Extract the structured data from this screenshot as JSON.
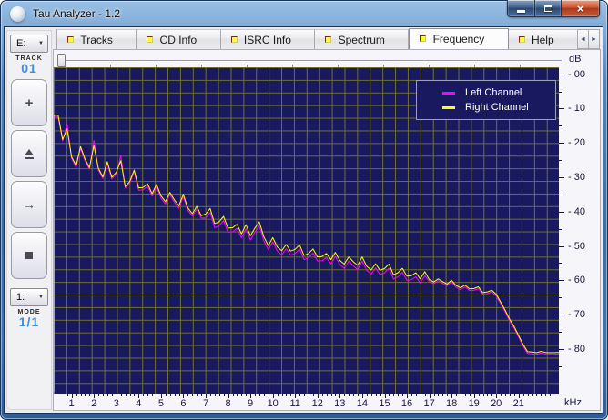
{
  "window": {
    "title": "Tau Analyzer - 1.2",
    "controls": {
      "close_glyph": "×"
    }
  },
  "tabs": [
    {
      "label": "Tracks",
      "active": false
    },
    {
      "label": "CD Info",
      "active": false
    },
    {
      "label": "ISRC Info",
      "active": false
    },
    {
      "label": "Spectrum",
      "active": false
    },
    {
      "label": "Frequency",
      "active": true
    },
    {
      "label": "Help",
      "active": false
    }
  ],
  "tab_scroll": {
    "left_glyph": "◄",
    "right_glyph": "►"
  },
  "sidebar": {
    "drive_value": "E:",
    "track_label": "TRACK",
    "track_value": "01",
    "plus_glyph": "+",
    "next_glyph": "→",
    "mode_drop_value": "1:",
    "mode_label": "MODE",
    "mode_value": "1/1"
  },
  "legend": {
    "items": [
      {
        "label": "Left Channel",
        "color": "#ff00ff"
      },
      {
        "label": "Right Channel",
        "color": "#ffff00"
      }
    ]
  },
  "chart_data": {
    "type": "line",
    "title": "",
    "xlabel": "kHz",
    "ylabel": "dB",
    "xlim": [
      0.2,
      22.8
    ],
    "ylim": [
      -93,
      2
    ],
    "grid": true,
    "legend_position": "top-right",
    "plot_bg": "#191960",
    "grid_color": "#70702c",
    "y_tick_prefix": "- ",
    "x_ticks": [
      1,
      2,
      3,
      4,
      5,
      6,
      7,
      8,
      9,
      10,
      11,
      12,
      13,
      14,
      15,
      16,
      17,
      18,
      19,
      20,
      21
    ],
    "x_tick_labels": [
      "1",
      "2",
      "3",
      "4",
      "5",
      "6",
      "7",
      "8",
      "9",
      "10",
      "11",
      "12",
      "13",
      "14",
      "15",
      "16",
      "17",
      "18",
      "19",
      "20",
      "21"
    ],
    "y_ticks": [
      0,
      -10,
      -20,
      -30,
      -40,
      -50,
      -60,
      -70,
      -80
    ],
    "y_tick_labels": [
      "00",
      "10",
      "20",
      "30",
      "40",
      "50",
      "60",
      "70",
      "80"
    ],
    "x": [
      0.2,
      0.2,
      0.4,
      0.6,
      0.8,
      1,
      1.2,
      1.4,
      1.6,
      1.8,
      2,
      2.2,
      2.4,
      2.6,
      2.8,
      3,
      3.2,
      3.4,
      3.6,
      3.8,
      4,
      4.2,
      4.4,
      4.6,
      4.8,
      5,
      5.2,
      5.4,
      5.6,
      5.8,
      6,
      6.2,
      6.4,
      6.6,
      6.8,
      7,
      7.2,
      7.4,
      7.6,
      7.8,
      8,
      8.2,
      8.4,
      8.6,
      8.8,
      9,
      9.2,
      9.4,
      9.6,
      9.8,
      10,
      10.2,
      10.4,
      10.6,
      10.8,
      11,
      11.2,
      11.4,
      11.6,
      11.8,
      12,
      12.2,
      12.4,
      12.6,
      12.8,
      13,
      13.2,
      13.4,
      13.6,
      13.8,
      14,
      14.2,
      14.4,
      14.6,
      14.8,
      15,
      15.2,
      15.4,
      15.6,
      15.8,
      16,
      16.2,
      16.4,
      16.6,
      16.8,
      17,
      17.2,
      17.4,
      17.6,
      17.8,
      18,
      18.2,
      18.4,
      18.6,
      18.8,
      19,
      19.2,
      19.4,
      19.6,
      19.8,
      20,
      20.2,
      20.4,
      20.6,
      20.8,
      21,
      21.2,
      21.4,
      21.6,
      21.8,
      22,
      22.2,
      22.4,
      22.8
    ],
    "series": [
      {
        "name": "Left Channel",
        "color": "#ff00ff",
        "y": [
          -92.5,
          -12.5,
          -12.5,
          -19.5,
          -14.5,
          -24.5,
          -27.1,
          -21.6,
          -25.2,
          -27.7,
          -19.3,
          -27.9,
          -30.4,
          -26.0,
          -30.5,
          -29.1,
          -23.7,
          -33.2,
          -31.8,
          -28.4,
          -33.8,
          -33.7,
          -32.6,
          -35.5,
          -32.8,
          -36.1,
          -37.8,
          -35.1,
          -37.3,
          -39.0,
          -35.7,
          -39.6,
          -41.3,
          -39.2,
          -41.9,
          -41.9,
          -40.3,
          -44.7,
          -44.2,
          -42.6,
          -46.0,
          -45.9,
          -44.9,
          -47.7,
          -45.0,
          -48.3,
          -46.0,
          -44.2,
          -48.5,
          -51.1,
          -48.8,
          -51.5,
          -52.6,
          -50.8,
          -52.7,
          -52.2,
          -50.9,
          -54.0,
          -53.4,
          -52.1,
          -54.4,
          -54.3,
          -53.4,
          -55.2,
          -53.1,
          -55.4,
          -56.5,
          -54.4,
          -55.8,
          -56.9,
          -54.4,
          -57.1,
          -58.2,
          -56.4,
          -58.3,
          -57.8,
          -56.5,
          -59.6,
          -59.0,
          -57.7,
          -60.0,
          -59.9,
          -59.0,
          -60.8,
          -58.7,
          -60.3,
          -61.0,
          -60.1,
          -60.9,
          -61.6,
          -60.5,
          -62.0,
          -62.7,
          -61.9,
          -63.0,
          -62.9,
          -62.4,
          -64.1,
          -63.9,
          -63.4,
          -64.6,
          -66.9,
          -69.3,
          -71.9,
          -74.0,
          -76.6,
          -79.2,
          -81.3,
          -81.4,
          -81.6,
          -81.2,
          -81.5,
          -81.6,
          -81.5
        ]
      },
      {
        "name": "Right Channel",
        "color": "#ffff00",
        "y": [
          -92.5,
          -12.0,
          -12.0,
          -19.0,
          -16.0,
          -24.0,
          -26.6,
          -21.1,
          -24.7,
          -27.2,
          -20.8,
          -27.4,
          -29.9,
          -25.5,
          -30.0,
          -28.6,
          -25.2,
          -32.7,
          -31.3,
          -27.9,
          -33.1,
          -33.0,
          -31.9,
          -34.8,
          -32.1,
          -35.4,
          -37.1,
          -34.4,
          -36.6,
          -38.3,
          -35.0,
          -38.9,
          -40.6,
          -38.5,
          -41.2,
          -40.7,
          -39.1,
          -43.5,
          -43.0,
          -41.4,
          -44.8,
          -44.7,
          -43.7,
          -46.5,
          -43.8,
          -47.1,
          -44.8,
          -43.0,
          -47.3,
          -49.9,
          -47.6,
          -50.3,
          -51.4,
          -49.6,
          -51.5,
          -51.0,
          -49.7,
          -52.8,
          -52.2,
          -50.9,
          -53.2,
          -53.1,
          -52.2,
          -54.0,
          -51.9,
          -54.2,
          -55.3,
          -53.2,
          -54.6,
          -55.7,
          -53.2,
          -55.9,
          -57.0,
          -55.2,
          -57.1,
          -56.6,
          -55.3,
          -58.4,
          -57.8,
          -56.5,
          -58.8,
          -58.7,
          -57.8,
          -59.6,
          -57.5,
          -59.8,
          -60.5,
          -59.6,
          -60.4,
          -61.1,
          -60.0,
          -61.5,
          -62.2,
          -61.4,
          -62.5,
          -62.4,
          -61.9,
          -63.6,
          -63.4,
          -62.9,
          -64.1,
          -66.4,
          -68.8,
          -71.4,
          -73.5,
          -76.1,
          -78.7,
          -80.8,
          -80.9,
          -81.1,
          -80.7,
          -81.0,
          -81.1,
          -81.0
        ]
      }
    ]
  }
}
